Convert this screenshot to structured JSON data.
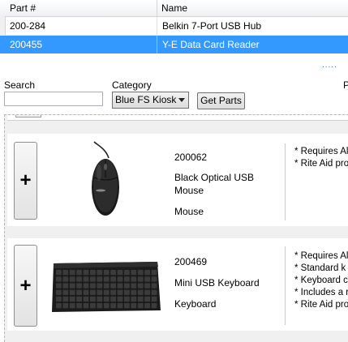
{
  "grid": {
    "columns": [
      "Part #",
      "Name"
    ],
    "rows": [
      {
        "part": "200-284",
        "name": "Belkin 7-Port USB Hub",
        "selected": false
      },
      {
        "part": "200455",
        "name": "Y-E Data Card Reader",
        "selected": true
      }
    ]
  },
  "splitter": {
    "grip": "....."
  },
  "filters": {
    "search_label": "Search",
    "search_value": "",
    "category_label": "Category",
    "category_value": "Blue FS Kiosk",
    "get_parts_label": "Get Parts",
    "cut_label": "P"
  },
  "products": [
    {
      "add_label": "+",
      "part": "200062",
      "name": "Black Optical USB Mouse",
      "type": "Mouse",
      "image_icon": "usb-mouse-icon",
      "notes": [
        "* Requires Al",
        "* Rite Aid pro"
      ]
    },
    {
      "add_label": "+",
      "part": "200469",
      "name": "Mini USB Keyboard",
      "type": "Keyboard",
      "image_icon": "usb-keyboard-icon",
      "notes": [
        "* Requires Al",
        "* Standard k",
        "* Keyboard c",
        "* Includes a r",
        "* Rite Aid pro"
      ]
    }
  ],
  "colors": {
    "selection": "#3399ff",
    "panel": "#f0f0f0"
  }
}
